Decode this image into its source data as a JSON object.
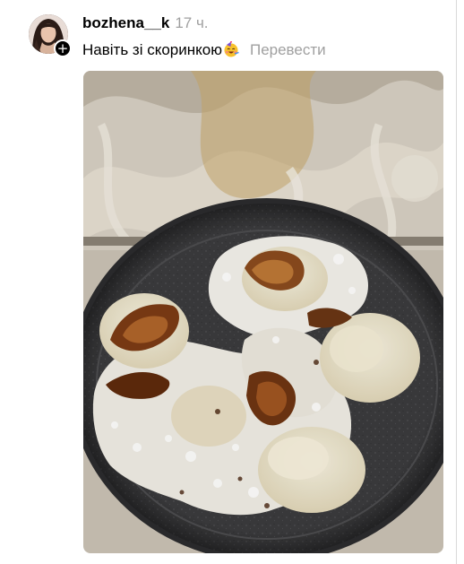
{
  "post": {
    "username": "bozhena__k",
    "timestamp": "17 ч.",
    "caption": "Навіть зі скоринкою",
    "translate_label": "Перевести",
    "follow_badge_glyph": "+",
    "avatar_icon": "avatar-photo",
    "emoji_icon": "party-face-emoji",
    "photo_subject": "pan-with-fried-syrnyky"
  },
  "colors": {
    "text": "#000000",
    "muted": "#a0a0a0",
    "badge": "#000000"
  }
}
